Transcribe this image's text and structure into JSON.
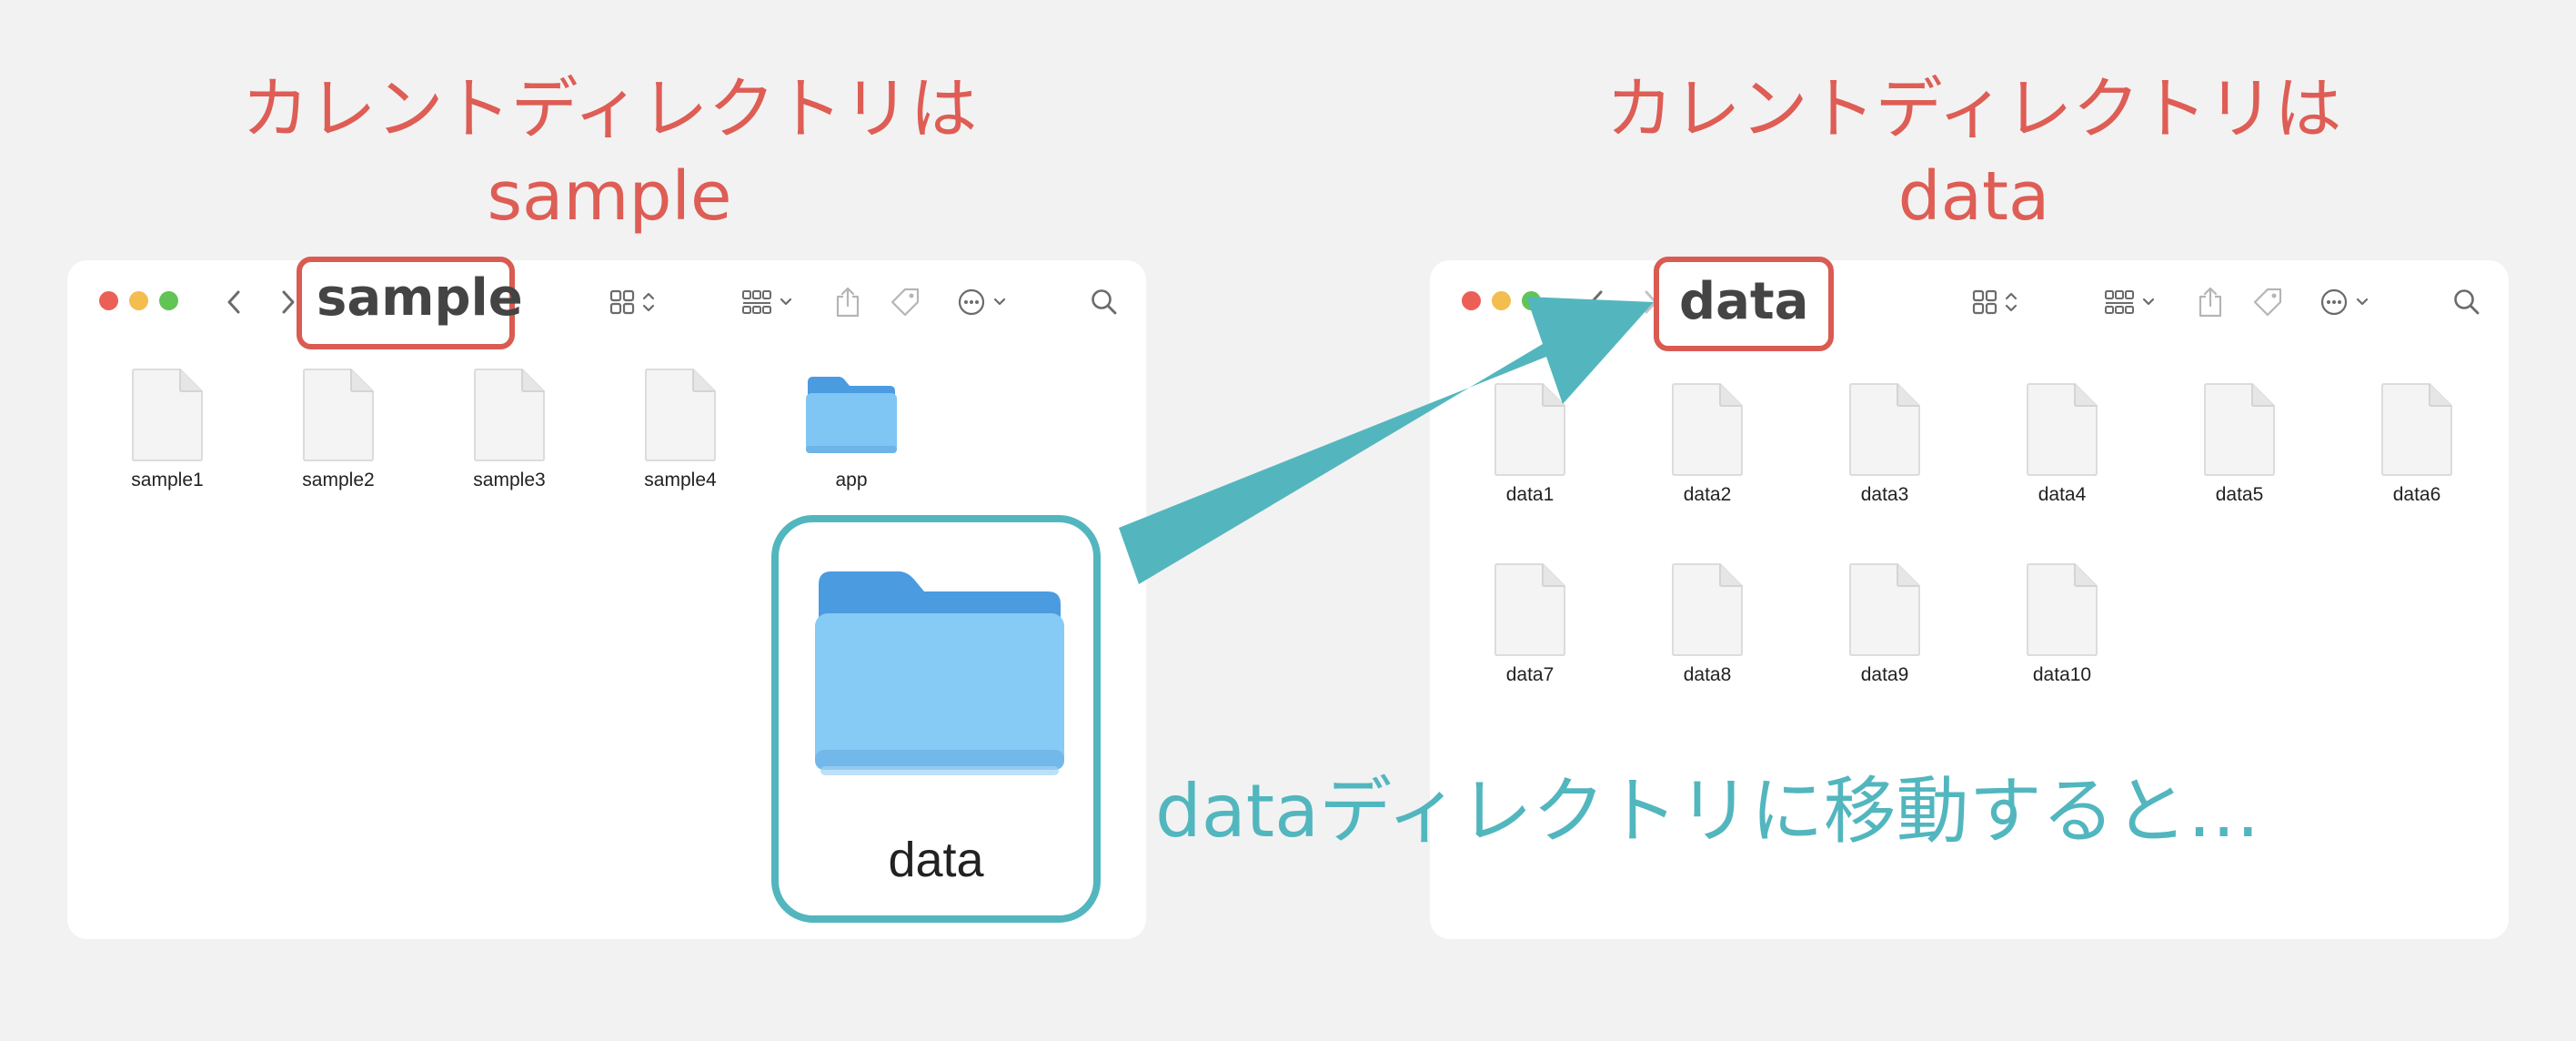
{
  "captions": {
    "left": {
      "line1": "カレントディレクトリは",
      "line2": "sample"
    },
    "right": {
      "line1": "カレントディレクトリは",
      "line2": "data"
    }
  },
  "left_window": {
    "title": "sample",
    "items": [
      "sample1",
      "sample2",
      "sample3",
      "sample4",
      "app"
    ],
    "highlighted_folder": "data"
  },
  "right_window": {
    "title": "data",
    "items": [
      "data1",
      "data2",
      "data3",
      "data4",
      "data5",
      "data6",
      "data7",
      "data8",
      "data9",
      "data10"
    ]
  },
  "annotation": "dataディレクトリに移動すると…",
  "icons": [
    "back-chevron-icon",
    "forward-chevron-icon",
    "grid-view-icon",
    "group-by-icon",
    "share-icon",
    "tag-icon",
    "more-icon",
    "search-icon",
    "document-icon",
    "folder-icon"
  ],
  "colors": {
    "highlight_red": "#d95b52",
    "accent_teal": "#53b6be",
    "caption_red": "#de5d55",
    "folder_blue": "#7fc6f4"
  }
}
